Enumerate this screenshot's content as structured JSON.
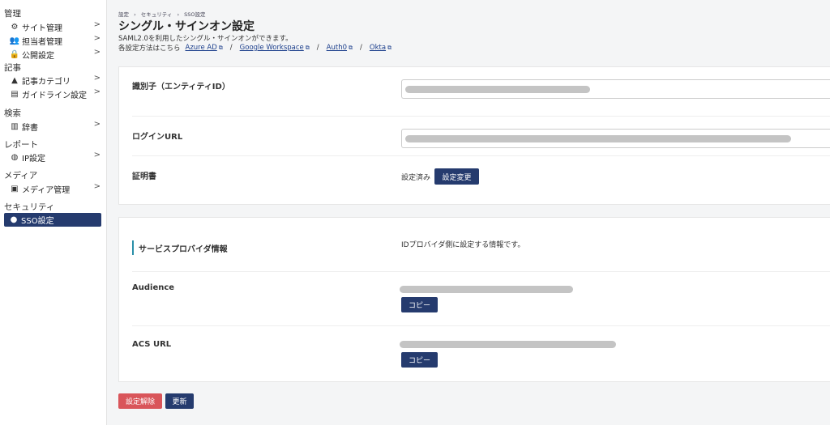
{
  "sidebar": {
    "sections": [
      {
        "title": "管理",
        "items": [
          {
            "label": "サイト管理",
            "icon": "gear-icon",
            "chevron": ">"
          },
          {
            "label": "担当者管理",
            "icon": "users-icon",
            "chevron": ">"
          },
          {
            "label": "公開設定",
            "icon": "lock-icon",
            "chevron": ">"
          }
        ]
      },
      {
        "title": "記事",
        "items": [
          {
            "label": "記事カテゴリ",
            "icon": "category-icon",
            "chevron": ">"
          },
          {
            "label": "ガイドライン設定",
            "icon": "guideline-icon",
            "chevron": ">"
          }
        ]
      },
      {
        "title": "検索",
        "items": [
          {
            "label": "辞書",
            "icon": "book-icon",
            "chevron": ">"
          }
        ]
      },
      {
        "title": "レポート",
        "items": [
          {
            "label": "IP設定",
            "icon": "ip-icon",
            "chevron": ">"
          }
        ]
      },
      {
        "title": "メディア",
        "items": [
          {
            "label": "メディア管理",
            "icon": "media-icon",
            "chevron": ">"
          }
        ]
      },
      {
        "title": "セキュリティ",
        "items": [
          {
            "label": "SSO設定",
            "icon": "shield-icon",
            "chevron": ""
          }
        ]
      }
    ]
  },
  "breadcrumb": [
    "設定",
    "›",
    "セキュリティ",
    "›",
    "SSO設定"
  ],
  "page": {
    "title": "シングル・サインオン設定",
    "description": "SAML2.0を利用したシングル・サインオンができます。",
    "guide_prefix": "各設定方法はこちら",
    "guide_links": [
      "Azure AD",
      "Google Workspace",
      "Auth0",
      "Okta"
    ],
    "separator": "/"
  },
  "idp": {
    "entity_label": "識別子（エンティティID）",
    "login_url_label": "ログインURL",
    "cert_label": "証明書",
    "cert_status": "設定済み",
    "cert_button": "設定変更"
  },
  "sp": {
    "heading": "サービスプロバイダ情報",
    "heading_note": "IDプロバイダ側に設定する情報です。",
    "audience_label": "Audience",
    "acs_label": "ACS URL",
    "copy_button": "コピー"
  },
  "actions": {
    "remove": "設定解除",
    "update": "更新"
  },
  "colors": {
    "primary": "#253b6e",
    "danger": "#d9555a",
    "accent": "#2a8fa8"
  }
}
